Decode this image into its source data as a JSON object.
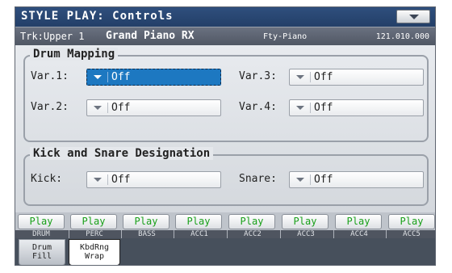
{
  "titlebar": {
    "title": "STYLE PLAY: Controls",
    "menu_icon": "chevron-down-icon"
  },
  "trackbar": {
    "track": "Trk:Upper 1",
    "sound": "Grand Piano RX",
    "bank": "Fty-Piano",
    "program": "121.010.000"
  },
  "drum_mapping": {
    "title": "Drum Mapping",
    "var1": {
      "label": "Var.1:",
      "value": "Off"
    },
    "var2": {
      "label": "Var.2:",
      "value": "Off"
    },
    "var3": {
      "label": "Var.3:",
      "value": "Off"
    },
    "var4": {
      "label": "Var.4:",
      "value": "Off"
    }
  },
  "kick_snare": {
    "title": "Kick and Snare Designation",
    "kick": {
      "label": "Kick:",
      "value": "Off"
    },
    "snare": {
      "label": "Snare:",
      "value": "Off"
    }
  },
  "tracks": [
    {
      "play": "Play",
      "name": "DRUM"
    },
    {
      "play": "Play",
      "name": "PERC"
    },
    {
      "play": "Play",
      "name": "BASS"
    },
    {
      "play": "Play",
      "name": "ACC1"
    },
    {
      "play": "Play",
      "name": "ACC2"
    },
    {
      "play": "Play",
      "name": "ACC3"
    },
    {
      "play": "Play",
      "name": "ACC4"
    },
    {
      "play": "Play",
      "name": "ACC5"
    }
  ],
  "tabs": [
    {
      "line1": "Drum",
      "line2": "Fill",
      "active": true
    },
    {
      "line1": "KbdRng",
      "line2": "Wrap",
      "active": false
    }
  ],
  "colors": {
    "title_bg": "#2f4f7d",
    "selected_field": "#1d78c1",
    "play_text": "#19a019"
  }
}
